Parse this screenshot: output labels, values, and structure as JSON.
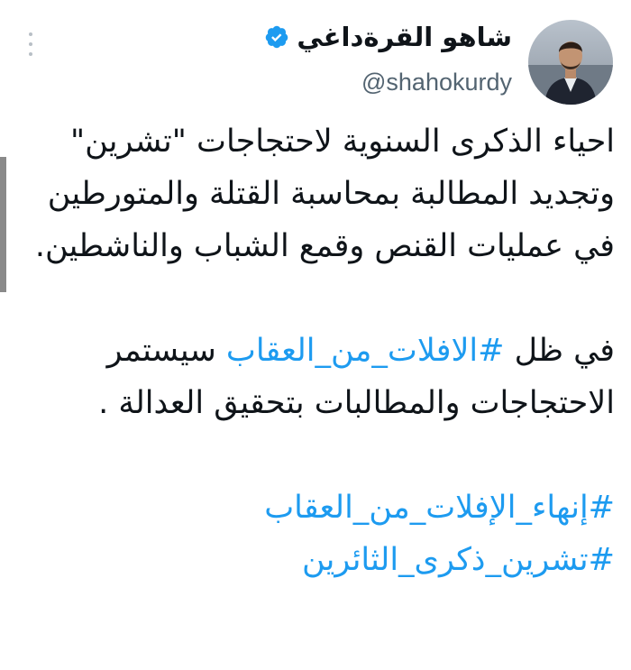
{
  "author": {
    "display_name": "شاهو القرةداغي",
    "handle": "@shahokurdy",
    "verified": true,
    "avatar_icon": "profile-photo"
  },
  "menu": {
    "icon": "more-vertical-icon"
  },
  "tweet": {
    "paragraph1": "احياء الذكرى السنوية لاحتجاجات \"تشرين\" وتجديد المطالبة بمحاسبة القتلة والمتورطين في عمليات القنص وقمع الشباب والناشطين.",
    "paragraph2_prefix": "في ظل ",
    "paragraph2_hashtag": "#الافلات_من_العقاب",
    "paragraph2_suffix": " سيستمر الاحتجاجات والمطالبات بتحقيق العدالة .",
    "hashtag1": "#إنهاء_الإفلات_من_العقاب",
    "hashtag2": "#تشرين_ذكرى_الثائرين"
  },
  "colors": {
    "text": "#0f1419",
    "secondary_text": "#536471",
    "link": "#1d9bf0",
    "verified_badge": "#1d9bf0"
  }
}
